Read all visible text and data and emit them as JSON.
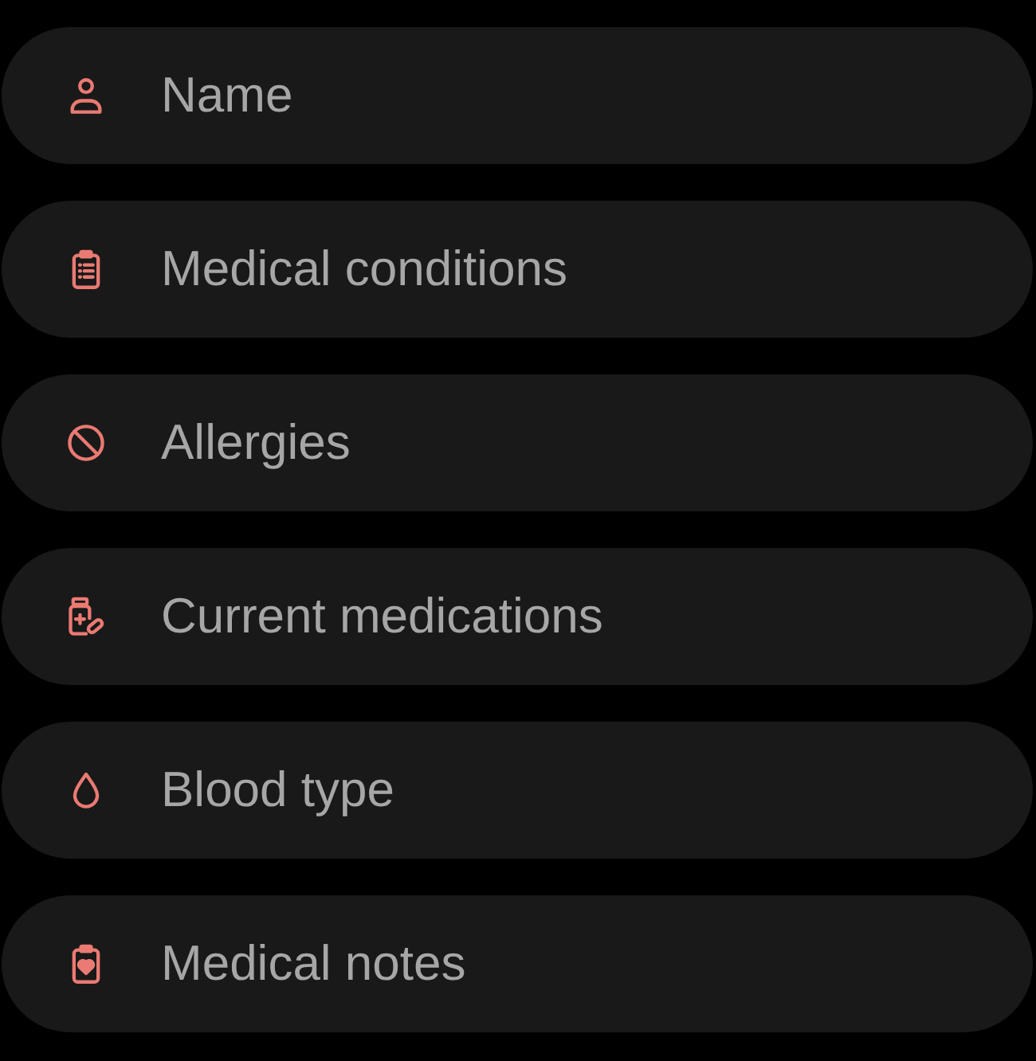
{
  "fields": [
    {
      "placeholder": "Name"
    },
    {
      "placeholder": "Medical conditions"
    },
    {
      "placeholder": "Allergies"
    },
    {
      "placeholder": "Current medications"
    },
    {
      "placeholder": "Blood type"
    },
    {
      "placeholder": "Medical notes"
    }
  ]
}
